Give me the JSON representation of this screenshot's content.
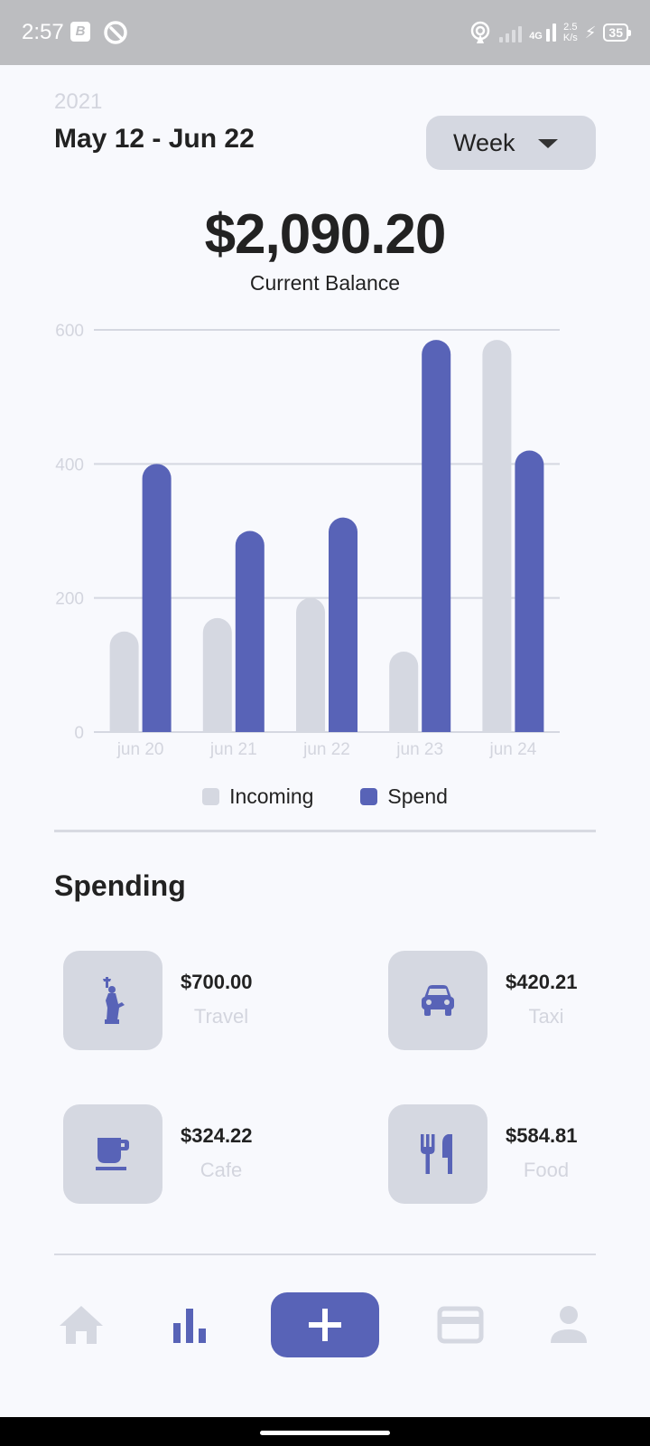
{
  "status_bar": {
    "time": "2:57",
    "app_badge": "B",
    "network": "4G",
    "speed_value": "2.5",
    "speed_unit": "K/s",
    "battery": "35"
  },
  "header": {
    "year": "2021",
    "date_range": "May 12 - Jun 22",
    "period_selector": "Week"
  },
  "balance": {
    "amount": "$2,090.20",
    "label": "Current Balance"
  },
  "chart_data": {
    "type": "bar",
    "categories": [
      "jun 20",
      "jun 21",
      "jun 22",
      "jun 23",
      "jun 24"
    ],
    "series": [
      {
        "name": "Incoming",
        "values": [
          150,
          170,
          200,
          120,
          585
        ],
        "color": "#d5d8e1"
      },
      {
        "name": "Spend",
        "values": [
          400,
          300,
          320,
          585,
          420
        ],
        "color": "#5863b7"
      }
    ],
    "yticks": [
      0,
      200,
      400,
      600
    ],
    "ylim": [
      0,
      600
    ],
    "grid": true,
    "legend": "bottom"
  },
  "spending": {
    "title": "Spending",
    "items": [
      {
        "amount": "$700.00",
        "category": "Travel",
        "icon": "statue-of-liberty-icon"
      },
      {
        "amount": "$420.21",
        "category": "Taxi",
        "icon": "car-icon"
      },
      {
        "amount": "$324.22",
        "category": "Cafe",
        "icon": "coffee-cup-icon"
      },
      {
        "amount": "$584.81",
        "category": "Food",
        "icon": "fork-knife-icon"
      }
    ]
  },
  "bottom_nav": {
    "items": [
      "home-icon",
      "stats-icon",
      "add-icon",
      "card-icon",
      "profile-icon"
    ],
    "active": "stats-icon",
    "accent": "#5863b7",
    "inactive": "#d5d8e1"
  }
}
